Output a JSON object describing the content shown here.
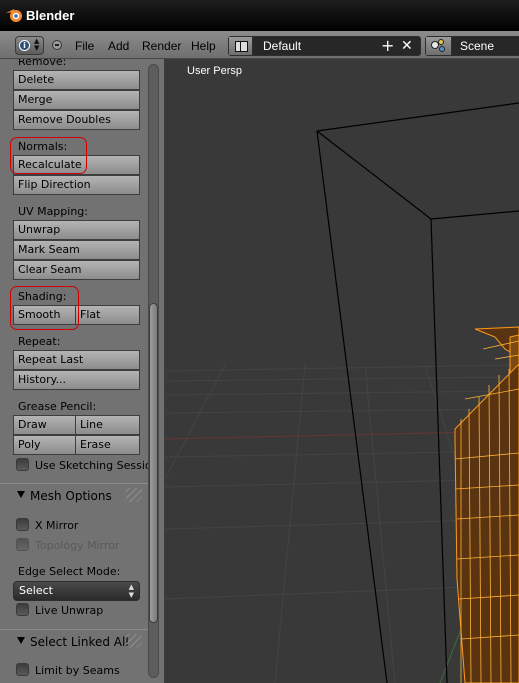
{
  "window": {
    "title": "Blender"
  },
  "header": {
    "menus": [
      "File",
      "Add",
      "Render",
      "Help"
    ],
    "layout_value": "Default",
    "scene_value": "Scene"
  },
  "toolshelf": {
    "remove_label": "Remove:",
    "delete": "Delete",
    "merge": "Merge",
    "remove_doubles": "Remove Doubles",
    "normals_label": "Normals:",
    "recalculate": "Recalculate",
    "flip_direction": "Flip Direction",
    "uv_label": "UV Mapping:",
    "unwrap": "Unwrap",
    "mark_seam": "Mark Seam",
    "clear_seam": "Clear Seam",
    "shading_label": "Shading:",
    "smooth": "Smooth",
    "flat": "Flat",
    "repeat_label": "Repeat:",
    "repeat_last": "Repeat Last",
    "history": "History...",
    "grease_label": "Grease Pencil:",
    "draw": "Draw",
    "line": "Line",
    "poly": "Poly",
    "erase": "Erase",
    "use_sketching": "Use Sketching Sessio",
    "mesh_options": "Mesh Options",
    "x_mirror": "X Mirror",
    "topology_mirror": "Topology Mirror",
    "edge_select_label": "Edge Select Mode:",
    "edge_select_value": "Select",
    "live_unwrap": "Live Unwrap",
    "select_linked_all": "Select Linked All",
    "limit_by_seams": "Limit by Seams"
  },
  "viewport": {
    "label": "User Persp"
  },
  "colors": {
    "highlight": "#d40000",
    "mesh_wire": "#ff9a1a",
    "viewport_bg": "#393939",
    "panel_bg": "#727272"
  }
}
